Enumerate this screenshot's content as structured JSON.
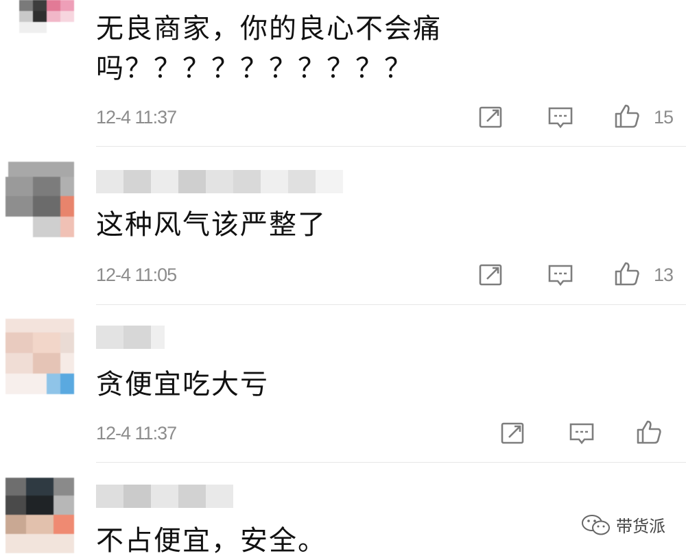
{
  "comments": [
    {
      "text_lines": [
        "无良商家，你的良心不会痛",
        "吗？？？？？？？？？？"
      ],
      "time": "12-4 11:37",
      "likes": "15"
    },
    {
      "text_lines": [
        "这种风气该严整了"
      ],
      "time": "12-4 11:05",
      "likes": "13"
    },
    {
      "text_lines": [
        "贪便宜吃大亏"
      ],
      "time": "12-4 11:37",
      "likes": ""
    },
    {
      "text_lines": [
        "不占便宜，安全。"
      ],
      "time": "",
      "likes": ""
    }
  ],
  "watermark": {
    "label": "带货派"
  },
  "icons": {
    "share": "share-icon",
    "reply": "reply-icon",
    "like": "thumbs-up-icon",
    "wechat": "wechat-icon"
  },
  "colors": {
    "text": "#111111",
    "meta": "#8c8c8c",
    "divider": "#e6e6e6"
  }
}
